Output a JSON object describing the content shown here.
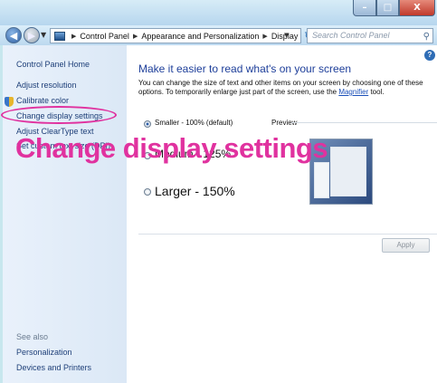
{
  "window": {
    "controls": {
      "minimize": "–",
      "maximize": "□",
      "close": "X"
    }
  },
  "navbar": {
    "breadcrumbs": [
      "Control Panel",
      "Appearance and Personalization",
      "Display"
    ],
    "search_placeholder": "Search Control Panel"
  },
  "sidebar": {
    "items": [
      {
        "label": "Control Panel Home"
      },
      {
        "label": "Adjust resolution"
      },
      {
        "label": "Calibrate color"
      },
      {
        "label": "Change display settings"
      },
      {
        "label": "Adjust ClearType text"
      },
      {
        "label": "Set custom text size (DPI)"
      }
    ],
    "see_also_heading": "See also",
    "see_also": [
      {
        "label": "Personalization"
      },
      {
        "label": "Devices and Printers"
      }
    ]
  },
  "main": {
    "heading": "Make it easier to read what's on your screen",
    "description_before": "You can change the size of text and other items on your screen by choosing one of these options. To temporarily enlarge just part of the screen, use the ",
    "magnifier_link": "Magnifier",
    "description_after": " tool.",
    "options": [
      {
        "label": "Smaller - 100% (default)",
        "selected": true
      },
      {
        "label": "Medium - 125%",
        "selected": false
      },
      {
        "label": "Larger - 150%",
        "selected": false
      }
    ],
    "preview_label": "Preview",
    "apply_label": "Apply"
  },
  "overlay": {
    "caption": "Change display settings",
    "highlight_color": "#e0329f"
  }
}
